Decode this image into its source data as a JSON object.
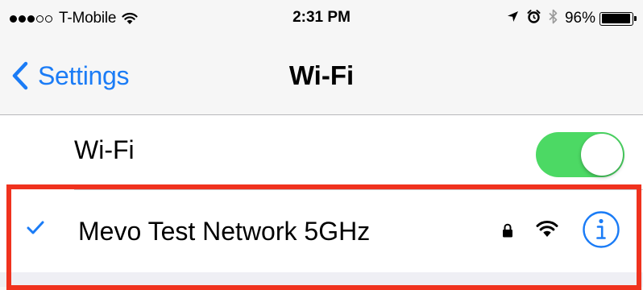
{
  "status_bar": {
    "signal_bars_filled": 3,
    "signal_bars_total": 5,
    "carrier": "T-Mobile",
    "time": "2:31 PM",
    "battery_percent": "96%",
    "icons": [
      "wifi-icon",
      "location-arrow-icon",
      "alarm-icon",
      "bluetooth-icon",
      "battery-icon"
    ]
  },
  "nav": {
    "back_label": "Settings",
    "title": "Wi-Fi"
  },
  "wifi_toggle": {
    "label": "Wi-Fi",
    "on": true
  },
  "network": {
    "name": "Mevo Test Network 5GHz",
    "connected": true,
    "secured": true
  },
  "colors": {
    "accent": "#1b7cf6",
    "toggle_on": "#4cd964",
    "highlight": "#f0321e",
    "bar_bg": "#f6f6f6"
  }
}
